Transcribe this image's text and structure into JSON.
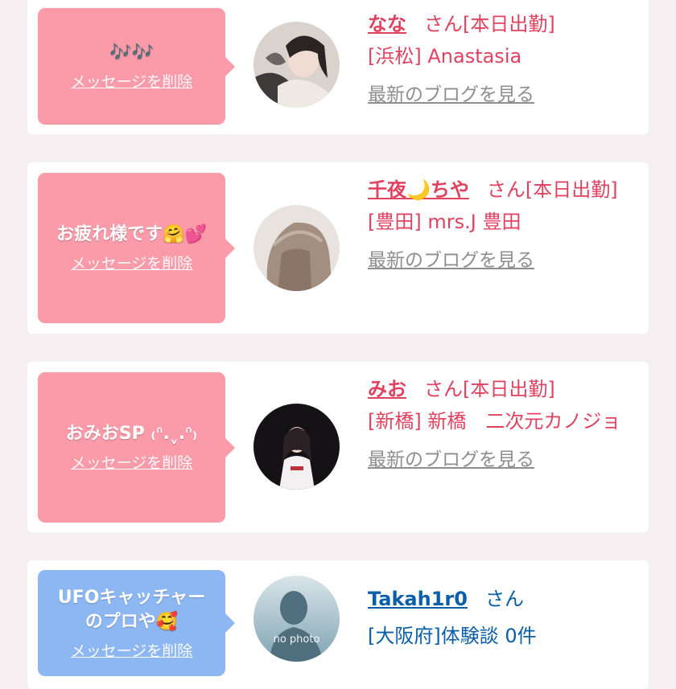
{
  "cards": [
    {
      "message": "🎶🎶",
      "delete_label": "メッセージを削除",
      "name": "なな",
      "honorific": "さん[本日出勤]",
      "shop": "[浜松] Anastasia",
      "blog_label": "最新のブログを見る"
    },
    {
      "message": "お疲れ様です🤗💕",
      "delete_label": "メッセージを削除",
      "name": "千夜🌙ちや",
      "honorific": "さん[本日出勤]",
      "shop": "[豊田] mrs.J 豊田",
      "blog_label": "最新のブログを見る"
    },
    {
      "message": "おみおSP ₍ᐢ.ˬ.ᐢ₎",
      "delete_label": "メッセージを削除",
      "name": "みお",
      "honorific": "さん[本日出勤]",
      "shop": "[新橋] 新橋　二次元カノジョ",
      "blog_label": "最新のブログを見る"
    },
    {
      "message": "UFOキャッチャーのプロや🥰",
      "delete_label": "メッセージを削除",
      "name": "Takah1r0",
      "honorific": "さん",
      "shop": "[大阪府]体験談 0件",
      "avatar_text": "no photo"
    }
  ],
  "colors": {
    "pink_bubble": "#fb9aa8",
    "blue_bubble": "#8cb7f3",
    "pink_text": "#e0425f",
    "blue_text": "#0b5ea8"
  }
}
